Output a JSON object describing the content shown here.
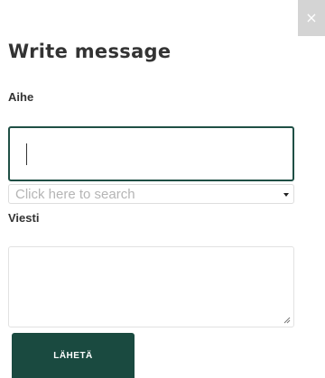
{
  "dialog": {
    "close_glyph": "×",
    "title": "Write message"
  },
  "form": {
    "subject_label": "Aihe",
    "subject_value": "",
    "search_placeholder": "Click here to search",
    "message_label": "Viesti",
    "message_value": "",
    "send_label": "LÄHETÄ"
  },
  "colors": {
    "accent": "#1a4a40",
    "close_bg": "#d4d4d4"
  }
}
